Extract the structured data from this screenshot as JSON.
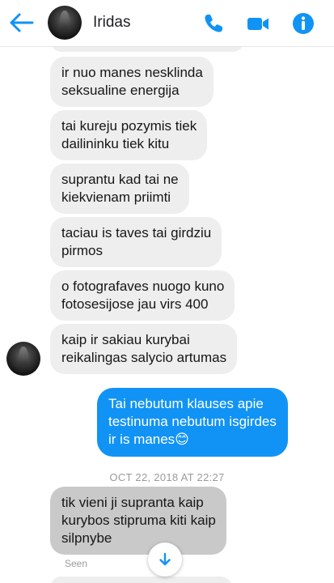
{
  "header": {
    "contact_name": "Iridas",
    "back_icon": "back-arrow-icon",
    "call_icon": "phone-icon",
    "video_icon": "video-camera-icon",
    "info_icon": "info-icon",
    "accent_color": "#1193f5"
  },
  "messages": [
    {
      "direction": "incoming",
      "text": "ir nuo manes nesklinda\nseksualine energija"
    },
    {
      "direction": "incoming",
      "text": "tai kureju pozymis tiek\ndailininku tiek kitu"
    },
    {
      "direction": "incoming",
      "text": "suprantu kad tai ne\nkiekvienam priimti"
    },
    {
      "direction": "incoming",
      "text": "taciau is taves tai girdziu\npirmos"
    },
    {
      "direction": "incoming",
      "text": "o fotografaves nuogo kuno\nfotosesijose jau virs 400"
    },
    {
      "direction": "incoming",
      "text": "kaip ir sakiau kurybai\nreikalingas salycio artumas"
    },
    {
      "direction": "outgoing",
      "text": "Tai nebutum klauses apie\ntestinuma nebutum isgirdes\nir is manes😊"
    },
    {
      "direction": "incoming",
      "text": "tik vieni ji supranta kaip\nkurybos stipruma kiti kaip\nsilpnybe"
    }
  ],
  "timestamp": "OCT 22, 2018 AT 22:27",
  "seen_label": "Seen",
  "scroll_icon": "arrow-down-icon"
}
